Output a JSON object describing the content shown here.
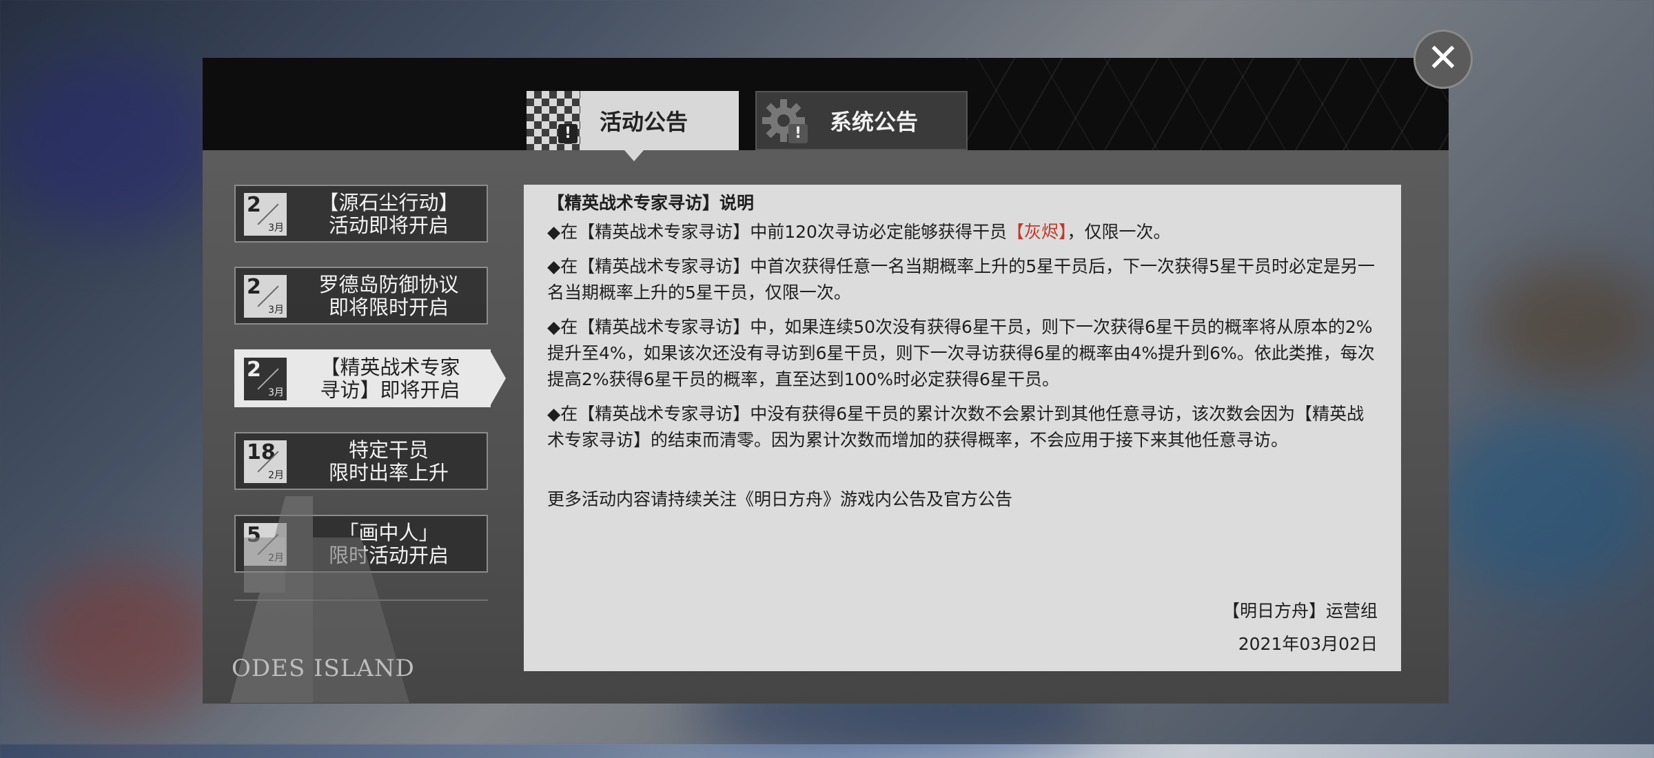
{
  "tabs": [
    {
      "label": "活动公告",
      "icon": "checker-alert-icon",
      "active": true
    },
    {
      "label": "系统公告",
      "icon": "gear-alert-icon",
      "active": false
    }
  ],
  "announcements": [
    {
      "day": "2",
      "month": "3月",
      "title_line1": "【源石尘行动】",
      "title_line2": "活动即将开启"
    },
    {
      "day": "2",
      "month": "3月",
      "title_line1": "罗德岛防御协议",
      "title_line2": "即将限时开启"
    },
    {
      "day": "2",
      "month": "3月",
      "title_line1": "【精英战术专家",
      "title_line2": "寻访】即将开启"
    },
    {
      "day": "18",
      "month": "2月",
      "title_line1": "特定干员",
      "title_line2": "限时出率上升"
    },
    {
      "day": "5",
      "month": "2月",
      "title_line1": "「画中人」",
      "title_line2": "限时活动开启"
    }
  ],
  "content": {
    "title": "【精英战术专家寻访】说明",
    "p1_a": "◆在【精英战术专家寻访】中前120次寻访必定能够获得干员",
    "p1_red": "【灰烬】",
    "p1_b": "，仅限一次。",
    "p2": "◆在【精英战术专家寻访】中首次获得任意一名当期概率上升的5星干员后，下一次获得5星干员时必定是另一名当期概率上升的5星干员，仅限一次。",
    "p3": "◆在【精英战术专家寻访】中，如果连续50次没有获得6星干员，则下一次获得6星干员的概率将从原本的2%提升至4%，如果该次还没有寻访到6星干员，则下一次寻访获得6星的概率由4%提升到6%。依此类推，每次提高2%获得6星干员的概率，直至达到100%时必定获得6星干员。",
    "p4": "◆在【精英战术专家寻访】中没有获得6星干员的累计次数不会累计到其他任意寻访，该次数会因为【精英战术专家寻访】的结束而清零。因为累计次数而增加的获得概率，不会应用于接下来其他任意寻访。",
    "follow": "更多活动内容请持续关注《明日方舟》游戏内公告及官方公告",
    "signature": "【明日方舟】运营组",
    "date": "2021年03月02日"
  },
  "close_label": "✕",
  "logo_text": "ODES ISLAND",
  "colors": {
    "highlight": "#c0392b",
    "panel": "#505050",
    "content_bg": "#dcdcdc"
  }
}
